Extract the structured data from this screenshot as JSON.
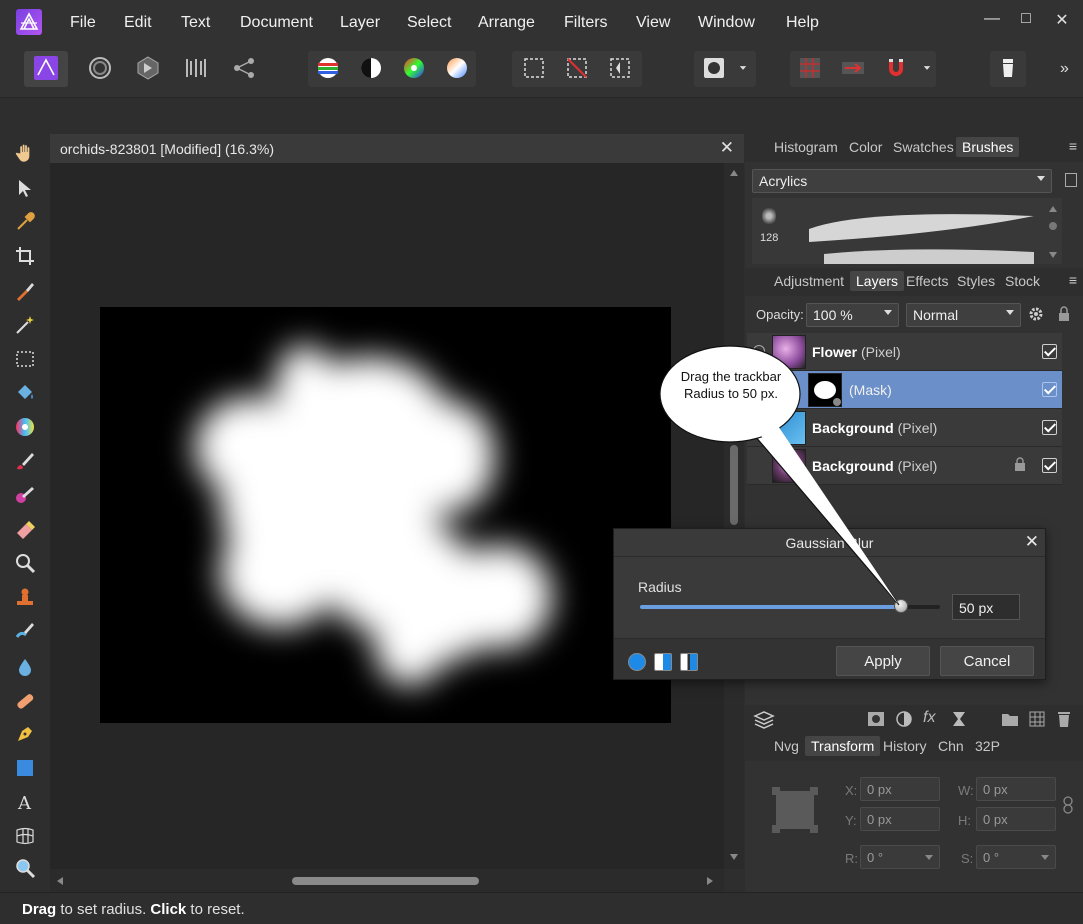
{
  "menu": {
    "items": [
      "File",
      "Edit",
      "Text",
      "Document",
      "Layer",
      "Select",
      "Arrange",
      "Filters",
      "View",
      "Window",
      "Help"
    ],
    "minimize": "—",
    "maximize": "□",
    "close": "✕"
  },
  "toolbar": {
    "overflow": "»"
  },
  "document": {
    "title": "orchids-823801 [Modified] (16.3%)",
    "close": "✕"
  },
  "status": {
    "drag_word": "Drag",
    "drag_rest": " to set radius. ",
    "click_word": "Click",
    "click_rest": " to reset."
  },
  "panels": {
    "top_tabs": [
      "Histogram",
      "Color",
      "Swatches",
      "Brushes"
    ],
    "top_active": "Brushes",
    "brush_category": "Acrylics",
    "brush_size": "128",
    "mid_tabs": [
      "Adjustment",
      "Layers",
      "Effects",
      "Styles",
      "Stock"
    ],
    "mid_active": "Layers",
    "opacity_label": "Opacity:",
    "opacity_value": "100 %",
    "blend_mode": "Normal",
    "layers": [
      {
        "name": "Flower",
        "type": "(Pixel)"
      },
      {
        "name": "",
        "type": "(Mask)"
      },
      {
        "name": "Background",
        "type": "(Pixel)"
      },
      {
        "name": "Background",
        "type": "(Pixel)"
      }
    ],
    "bottom_tabs": [
      "Nvg",
      "Transform",
      "History",
      "Chn",
      "32P"
    ],
    "bottom_active": "Transform",
    "transform": {
      "x_label": "X:",
      "x_value": "0 px",
      "y_label": "Y:",
      "y_value": "0 px",
      "w_label": "W:",
      "w_value": "0 px",
      "h_label": "H:",
      "h_value": "0 px",
      "r_label": "R:",
      "r_value": "0 °",
      "s_label": "S:",
      "s_value": "0 °"
    },
    "menu_glyph": "≡"
  },
  "dialog": {
    "title": "Gaussian Blur",
    "close": "✕",
    "radius_label": "Radius",
    "radius_value": "50 px",
    "radius_fraction": 0.87,
    "apply": "Apply",
    "cancel": "Cancel"
  },
  "callout": {
    "text": "Drag the trackbar Radius to 50 px."
  },
  "colors": {
    "accent": "#6b9ee0",
    "selected_layer": "#6b8fc8",
    "panel": "#323232",
    "canvas": "#262626"
  }
}
